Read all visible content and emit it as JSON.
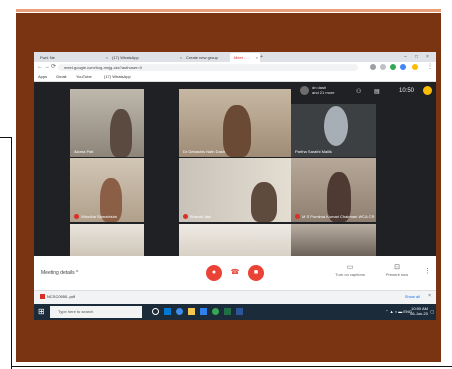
{
  "browser": {
    "tabs": [
      {
        "label": "Fwd: Ne"
      },
      {
        "label": "(17) WhatsApp"
      },
      {
        "label": "Create new group"
      },
      {
        "label": "Meet - ..."
      }
    ],
    "url": "meet.google.com/hxg-mnjg-cks?authuser=0",
    "bookmarks": [
      "Apps",
      "Gmail",
      "YouTube",
      "(17) WhatsApp"
    ]
  },
  "meet": {
    "others": [
      "dn dash",
      "and 21 more"
    ],
    "clock": "10:50",
    "participants": [
      {
        "name": "Aloma Pati",
        "muted": false
      },
      {
        "name": "Dr Debashis Nath Dash",
        "muted": false
      },
      {
        "name": "Partha Sarathi Mallik",
        "muted": false
      },
      {
        "name": "Nihodha Samatrishn",
        "muted": true
      },
      {
        "name": "Bharati Jani",
        "muted": true
      },
      {
        "name": "M S Purnima Kumari Chairman WCA CR",
        "muted": true
      }
    ],
    "controls": {
      "meeting_details": "Meeting details",
      "captions": "Turn on captions",
      "present": "Present now"
    }
  },
  "downloads": {
    "file": "NCSC0950..pdf",
    "show_all": "Show all"
  },
  "taskbar": {
    "search_placeholder": "Type here to search",
    "time": "10:50 AM",
    "date": "06-Jun-20"
  },
  "colors": {
    "frame_brown": "#7a3411",
    "meet_dark": "#202124",
    "end_call_red": "#ea4335"
  }
}
